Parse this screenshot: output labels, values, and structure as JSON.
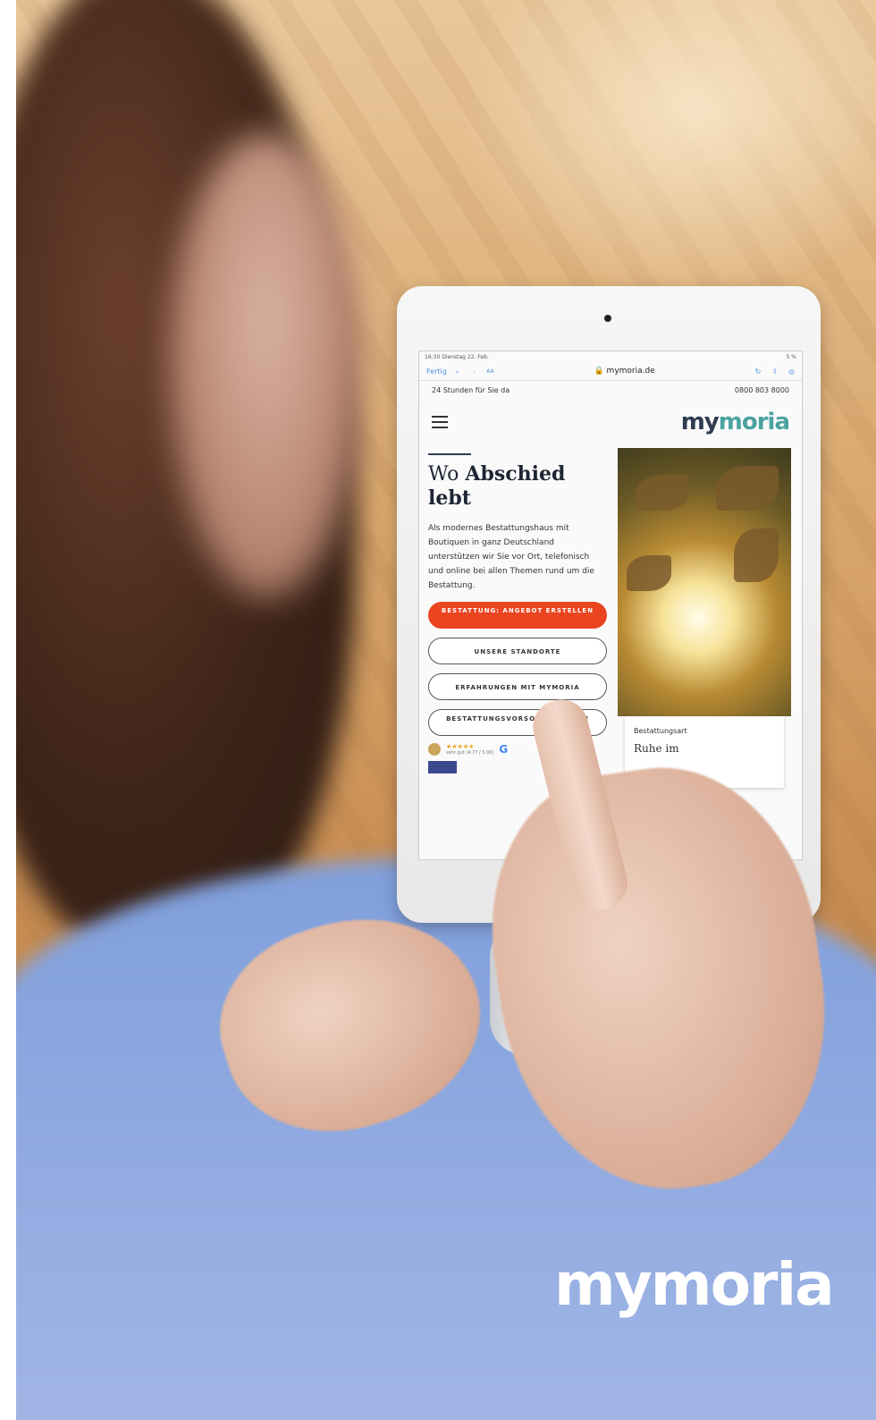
{
  "tablet": {
    "statusbar": {
      "time": "16:30 Dienstag 22. Feb.",
      "battery": "5 %"
    },
    "browser": {
      "done_label": "Fertig",
      "text_size": "AA",
      "url": "mymoria.de"
    },
    "site": {
      "topline_left": "24 Stunden für Sie da",
      "topline_right": "0800 803 8000",
      "logo_part1": "my",
      "logo_part2": "moria",
      "headline_normal": "Wo",
      "headline_bold": "Abschied lebt",
      "intro": "Als modernes Bestattungshaus mit Boutiquen in ganz Deutschland unterstützen wir Sie vor Ort, telefonisch und online bei allen Themen rund um die Bestattung.",
      "btn_primary": "BESTATTUNG: ANGEBOT ERSTELLEN",
      "btn_locations": "UNSERE STANDORTE",
      "btn_experiences": "ERFAHRUNGEN MIT MYMORIA",
      "btn_provision": "BESTATTUNGSVORSORGE PLANEN",
      "rating_stars": "★★★★★",
      "rating_text": "sehr gut (4.77 / 5.00)",
      "google_letter": "G",
      "card_small": "Bestattungsart",
      "card_title": "Ruhe im"
    }
  },
  "brand": {
    "part1": "my",
    "part2": "moria"
  }
}
